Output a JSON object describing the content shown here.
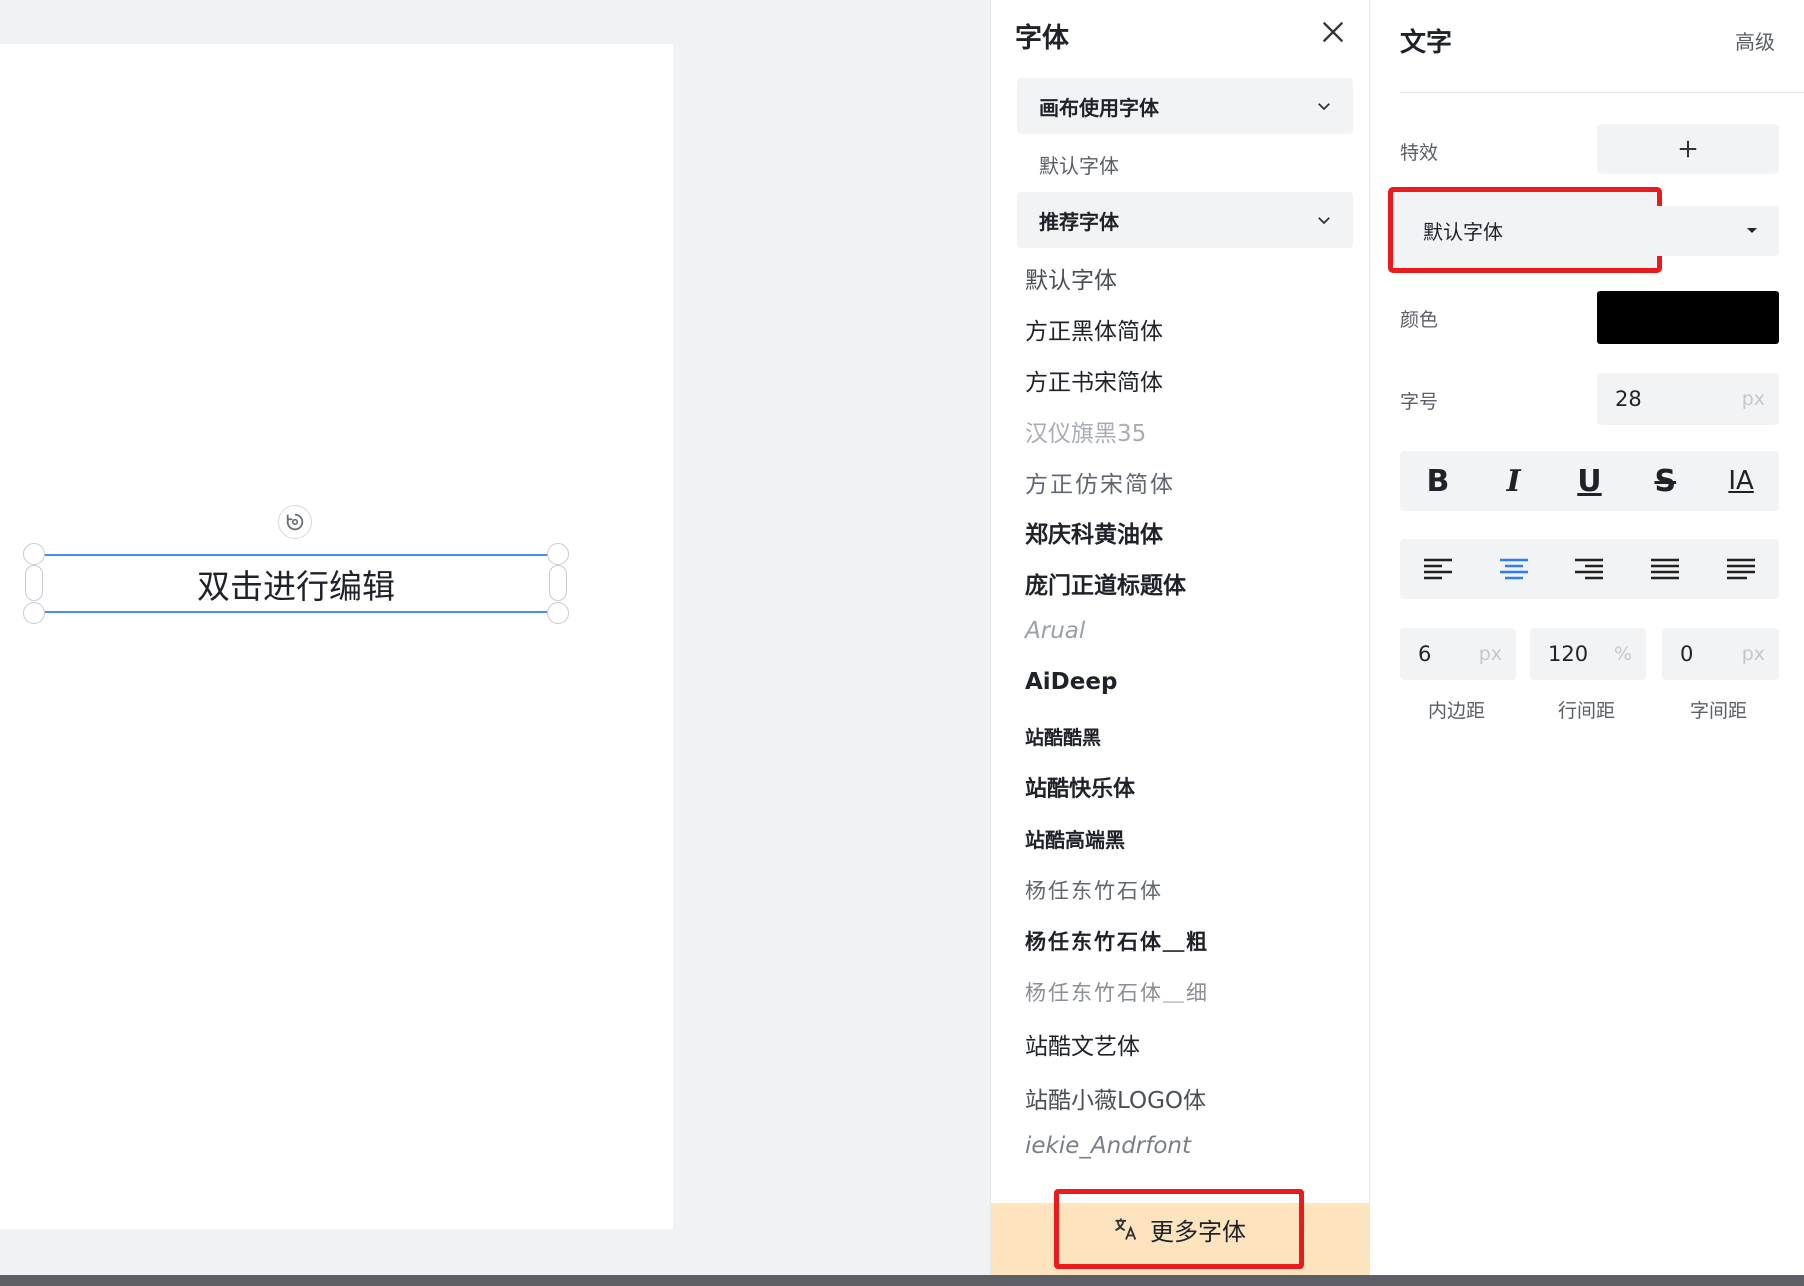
{
  "canvas": {
    "text_box_content": "双击进行编辑"
  },
  "font_panel": {
    "title": "字体",
    "close_icon": "close-icon",
    "groups": [
      {
        "label": "画布使用字体",
        "icon": "chevron-down-icon"
      },
      {
        "label": "推荐字体",
        "icon": "chevron-down-icon"
      }
    ],
    "canvas_fonts": [
      "默认字体"
    ],
    "recommended_fonts": [
      "默认字体",
      "方正黑体简体",
      "方正书宋简体",
      "汉仪旗黑35",
      "方正仿宋简体",
      "郑庆科黄油体",
      "庞门正道标题体",
      "Arual",
      "AiDeep",
      "站酷酷黑",
      "站酷快乐体",
      "站酷高端黑",
      "杨任东竹石体",
      "杨任东竹石体＿粗",
      "杨任东竹石体＿细",
      "站酷文艺体",
      "站酷小薇LOGO体",
      "iekie_Andrfont"
    ],
    "more_button": {
      "label": "更多字体",
      "icon": "translate-icon"
    },
    "footer_color": "#fde4bf"
  },
  "text_panel": {
    "title": "文字",
    "advanced_label": "高级",
    "effects_label": "特效",
    "effects_add_icon": "plus-icon",
    "font_select_value": "默认字体",
    "font_select_icon": "caret-down-icon",
    "color_label": "颜色",
    "color_value": "#000000",
    "size_label": "字号",
    "size_value": "28",
    "size_unit": "px",
    "style_buttons": [
      {
        "label": "B",
        "icon": "bold-icon"
      },
      {
        "label": "I",
        "icon": "italic-icon"
      },
      {
        "label": "U",
        "icon": "underline-icon"
      },
      {
        "label": "S",
        "icon": "strikethrough-icon"
      },
      {
        "label": "IA",
        "icon": "text-direction-icon"
      }
    ],
    "align_buttons": [
      {
        "icon": "align-left-icon",
        "active": false
      },
      {
        "icon": "align-center-icon",
        "active": true
      },
      {
        "icon": "align-right-icon",
        "active": false
      },
      {
        "icon": "align-justify-icon",
        "active": false
      },
      {
        "icon": "align-distribute-icon",
        "active": false
      }
    ],
    "padding": {
      "value": "6",
      "unit": "px",
      "label": "内边距"
    },
    "line_height": {
      "value": "120",
      "unit": "%",
      "label": "行间距"
    },
    "letter_spacing": {
      "value": "0",
      "unit": "px",
      "label": "字间距"
    },
    "accent_color": "#2f7df6",
    "highlight_color": "#e81c1c"
  }
}
